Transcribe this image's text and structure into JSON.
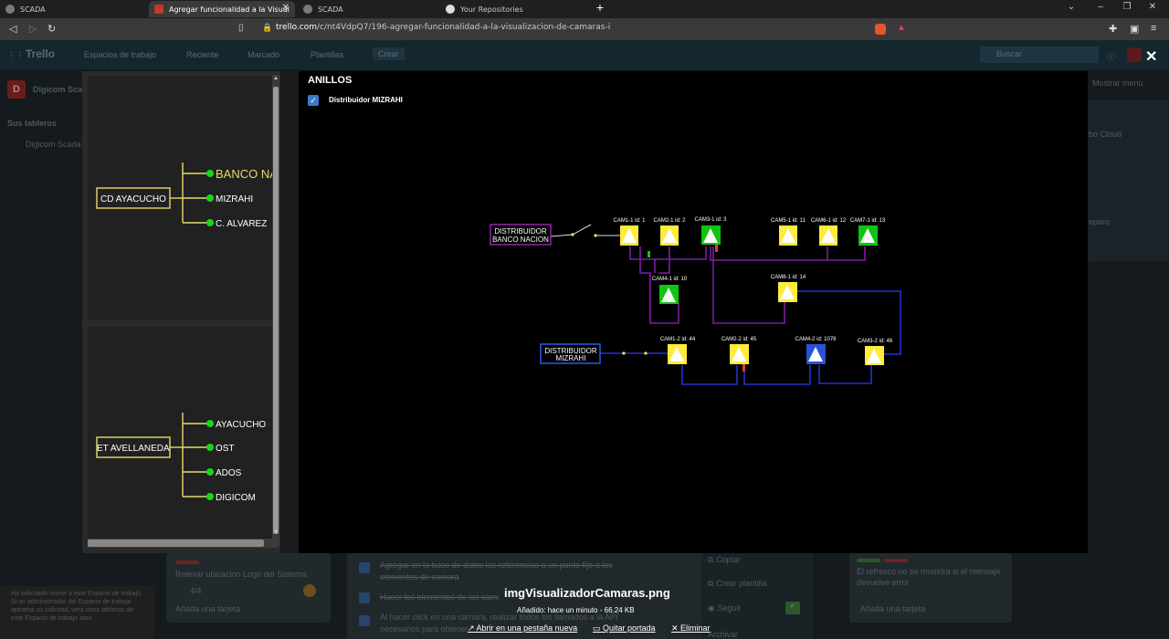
{
  "browser": {
    "tabs": [
      {
        "label": "SCADA",
        "active": false
      },
      {
        "label": "Agregar funcionalidad a la Visual",
        "active": true
      },
      {
        "label": "SCADA",
        "active": false
      },
      {
        "label": "Your Repositories",
        "active": false
      }
    ],
    "url_host": "trello.com",
    "url_path": "/c/nt4VdpQ7/196-agregar-funcionalidad-a-la-visualizacion-de-camaras-i"
  },
  "trello": {
    "logo": "Trello",
    "menu": [
      "Espacios de trabajo",
      "Reciente",
      "Marcado",
      "Plantillas"
    ],
    "create_label": "Crear",
    "search_placeholder": "Buscar",
    "workspace": "Digicom Sca",
    "boards_label": "Sus tableros",
    "board_item": "Digicom Scada",
    "show_menu": "Mostrar menú",
    "right_label_1": "bo Cloud",
    "right_label_2": "eparo",
    "card1_title": "Relevar ubicación Logo del Sistema",
    "card1_meta": "4/4",
    "card1_add": "Añada una tarjeta",
    "check_items": [
      "Agregar en la base de datos las referencias a un punto fijo a los elementos de camara",
      "Hacer los elementos de las camaras",
      "Al hacer click en una camara, realizar todos los llamados a la API necesarios para obtener"
    ],
    "side_actions": [
      "Copiar",
      "Crear plantilla",
      "Seguir",
      "Archivar"
    ],
    "card3_title": "El refresco no se muestra si el mensaje devuelve error",
    "card3_add": "Añada una tarjeta",
    "notice": "Ha solicitado unirse a este Espacio de trabajo. Si un administrador del Espacio de trabajo aprueba su solicitud, verá otros tableros de este Espacio de trabajo aquí."
  },
  "modal": {
    "section_title": "ANILLOS",
    "checkbox_label": "Distribuidor MIZRAHI",
    "tree1": {
      "root": "CD AYACUCHO",
      "leaves": [
        "BANCO NA",
        "MIZRAHI",
        "C. ALVAREZ"
      ]
    },
    "tree2": {
      "root": "ET AVELLANEDA",
      "leaves": [
        "AYACUCHO",
        "OST",
        "ADOS",
        "DIGICOM"
      ]
    },
    "diagram": {
      "distributors": [
        "DISTRIBUIDOR\nBANCO NACION",
        "DISTRIBUIDOR\nMIZRAHI"
      ],
      "cameras": [
        "CAM1-1 id: 1",
        "CAM2-1 id: 2",
        "CAM3-1 id: 3",
        "CAM5-1 id: 11",
        "CAM6-1 id: 12",
        "CAM7-1 id: 13",
        "CAM4-1 id: 10",
        "CAM8-1 id: 14",
        "CAM1-2 id: 44",
        "CAM2-2 id: 45",
        "CAM4-2 id: 1078",
        "CAM3-2 id: 46"
      ]
    }
  },
  "image_viewer": {
    "filename": "imgVisualizadorCamaras.png",
    "meta": "Añadido: hace un minuto - 66.24 KB",
    "actions": [
      "Abrir en una pestaña nueva",
      "Quitar portada",
      "Eliminar"
    ]
  }
}
